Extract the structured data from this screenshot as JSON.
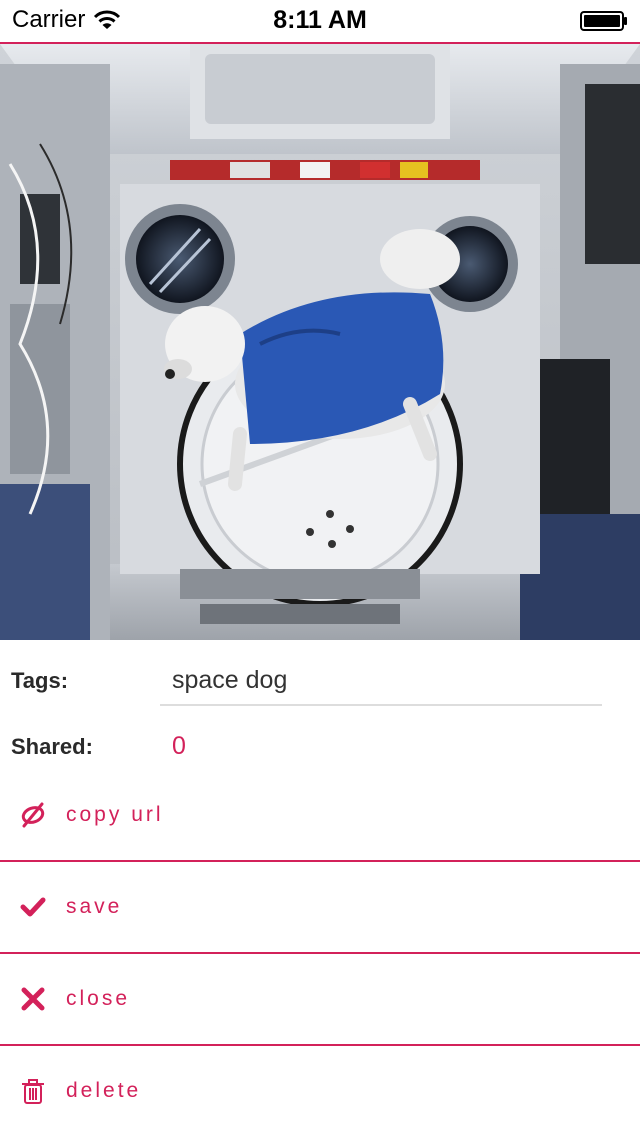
{
  "status_bar": {
    "carrier": "Carrier",
    "time": "8:11 AM",
    "icons": [
      "wifi-icon",
      "battery-icon"
    ]
  },
  "hero": {
    "icon": "photo-space-station-dog"
  },
  "details": {
    "tags_label": "Tags:",
    "tags_value": "space dog",
    "shared_label": "Shared:",
    "shared_value": "0"
  },
  "actions": [
    {
      "label": "copy url",
      "icon": "link-icon"
    },
    {
      "label": "save",
      "icon": "checkmark-icon"
    },
    {
      "label": "close",
      "icon": "close-icon"
    },
    {
      "label": "delete",
      "icon": "trash-icon"
    }
  ],
  "colors": {
    "accent": "#d3215a",
    "divider": "#dddddd",
    "text": "#2a2a2a"
  }
}
